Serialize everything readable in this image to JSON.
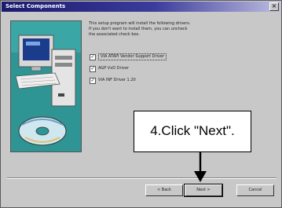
{
  "dialog": {
    "title": "Select Components",
    "close_glyph": "×",
    "description": "This setup program will install the following drivers.\nIf you don't want to install them, you can uncheck\nthe associated check box."
  },
  "options": [
    {
      "label": "VIA ATAPI Vendor Support Driver",
      "checked": true
    },
    {
      "label": "AGP VxD Driver",
      "checked": true
    },
    {
      "label": "VIA INF Driver 1.20",
      "checked": true
    }
  ],
  "buttons": {
    "back": "< Back",
    "next": "Next >",
    "cancel": "Cancel"
  },
  "callout": {
    "text": "4.Click \"Next\"."
  },
  "checkmark": "✓"
}
